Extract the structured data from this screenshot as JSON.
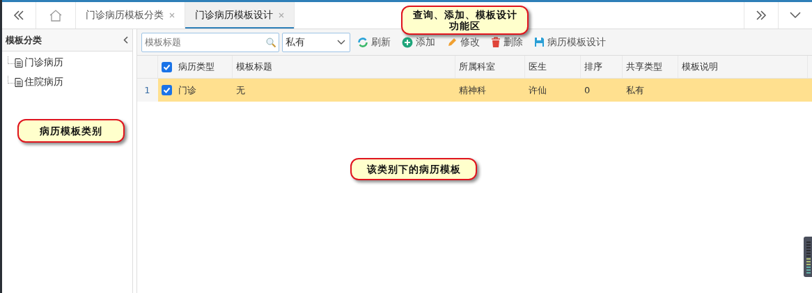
{
  "tab_bar": {
    "tabs": [
      {
        "label": "门诊病历模板分类",
        "selected": false
      },
      {
        "label": "门诊病历模板设计",
        "selected": true
      }
    ]
  },
  "sidebar": {
    "title": "模板分类",
    "items": [
      {
        "label": "门诊病历"
      },
      {
        "label": "住院病历"
      }
    ]
  },
  "toolbar": {
    "search": {
      "placeholder": "模板标题"
    },
    "share_select": {
      "value": "私有"
    },
    "buttons": [
      {
        "kind": "refresh",
        "label": "刷新"
      },
      {
        "kind": "add",
        "label": "添加"
      },
      {
        "kind": "edit",
        "label": "修改"
      },
      {
        "kind": "delete",
        "label": "删除"
      },
      {
        "kind": "design",
        "label": "病历模板设计"
      }
    ]
  },
  "table": {
    "header_checked": true,
    "columns": [
      "病历类型",
      "模板标题",
      "所属科室",
      "医生",
      "排序",
      "共享类型",
      "模板说明"
    ],
    "rows": [
      {
        "number": "1",
        "checked": true,
        "selected": true,
        "cells": [
          "门诊",
          "无",
          "精神科",
          "许仙",
          "0",
          "私有",
          ""
        ]
      }
    ]
  },
  "callouts": [
    {
      "kind": "toolbar",
      "text": "查询、添加、模板设计功能区"
    },
    {
      "kind": "sidebar",
      "text": "病历模板类别"
    },
    {
      "kind": "grid",
      "text": "该类别下的病历模板"
    }
  ]
}
